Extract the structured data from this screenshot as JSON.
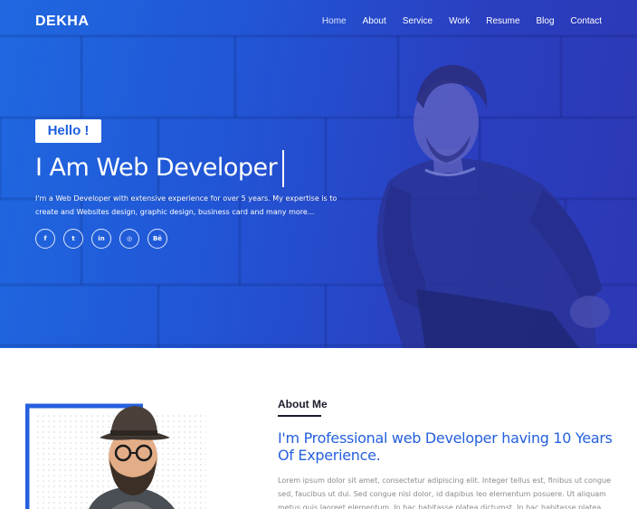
{
  "brand": "DEKHA",
  "nav": {
    "items": [
      "Home",
      "About",
      "Service",
      "Work",
      "Resume",
      "Blog",
      "Contact"
    ],
    "active": "Home"
  },
  "hero": {
    "greeting": "Hello !",
    "headline_prefix": "I Am",
    "headline_role": "Web Developer",
    "intro": "I'm a Web Developer with extensive experience for over 5 years. My expertise is to create and Websites design, graphic design, business card and many more...",
    "socials": [
      {
        "icon": "facebook-icon",
        "glyph": "f"
      },
      {
        "icon": "twitter-icon",
        "glyph": "t"
      },
      {
        "icon": "linkedin-icon",
        "glyph": "in"
      },
      {
        "icon": "instagram-icon",
        "glyph": "◎"
      },
      {
        "icon": "behance-icon",
        "glyph": "Bē"
      }
    ]
  },
  "about": {
    "title": "About Me",
    "heading": "I'm Professional web Developer having 10 Years Of Experience.",
    "text": "Lorem ipsum dolor sit amet, consectetur adipiscing elit. Integer tellus est, finibus ut congue sed, faucibus ut dui. Sed congue nisl dolor, id dapibus leo elementum posuere. Ut aliquam metus quis laoreet elementum. In hac habitasse platea dictumst. In hac habitasse platea"
  },
  "colors": {
    "accent": "#2560dd",
    "hero_gradient_start": "#1f68e0",
    "hero_gradient_end": "#2c38b4"
  }
}
